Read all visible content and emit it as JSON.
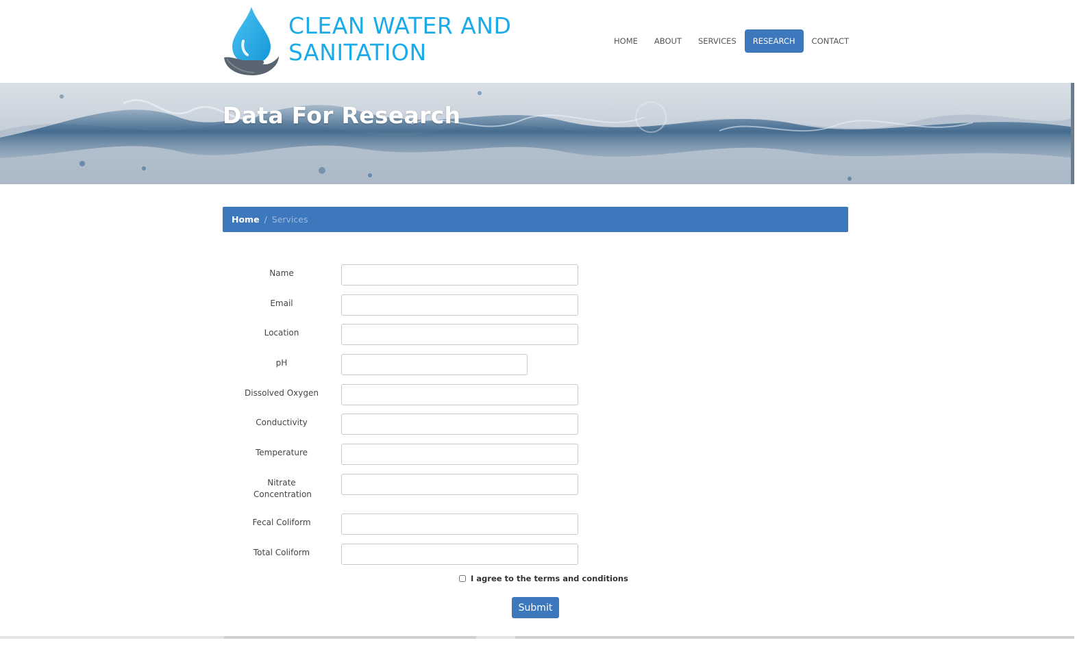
{
  "brand": {
    "line1": "CLEAN WATER AND",
    "line2": "SANITATION",
    "logo_icon": "water-drop-hand-icon",
    "color": "#1aabe8"
  },
  "nav": {
    "items": [
      {
        "label": "HOME",
        "active": false
      },
      {
        "label": "ABOUT",
        "active": false
      },
      {
        "label": "SERVICES",
        "active": false
      },
      {
        "label": "RESEARCH",
        "active": true
      },
      {
        "label": "CONTACT",
        "active": false
      }
    ],
    "active_color": "#3d78bd"
  },
  "banner": {
    "title": "Data For Research"
  },
  "breadcrumb": {
    "home": "Home",
    "separator": "/",
    "current": "Services"
  },
  "form": {
    "fields": [
      {
        "label": "Name",
        "value": ""
      },
      {
        "label": "Email",
        "value": ""
      },
      {
        "label": "Location",
        "value": ""
      },
      {
        "label": "pH",
        "value": ""
      },
      {
        "label": "Dissolved Oxygen",
        "value": ""
      },
      {
        "label": "Conductivity",
        "value": ""
      },
      {
        "label": "Temperature",
        "value": ""
      },
      {
        "label": "Nitrate Concentration",
        "value": ""
      },
      {
        "label": "Fecal Coliform",
        "value": ""
      },
      {
        "label": "Total Coliform",
        "value": ""
      }
    ],
    "terms_label": "I agree to the terms and conditions",
    "terms_checked": false,
    "submit_label": "Submit"
  }
}
